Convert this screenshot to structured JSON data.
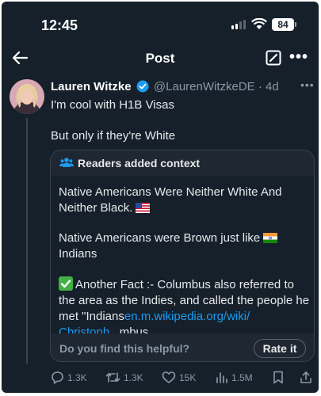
{
  "status_bar": {
    "time": "12:45",
    "battery": "84"
  },
  "header": {
    "title": "Post"
  },
  "post": {
    "author_name": "Lauren Witzke",
    "handle": "@LaurenWitzkeDE",
    "separator": "·",
    "age": "4d",
    "text_line1": "I'm cool with H1B Visas",
    "text_line2": "But only if they're White"
  },
  "context": {
    "title": "Readers added context",
    "para1": "Native Americans Were Neither White And Neither Black.",
    "para2": "Native Americans were Brown just like",
    "para2_end": "Indians",
    "para3": "Another Fact :- Columbus also referred to the area as the Indies, and called the people he met \"Indians",
    "link1": "en.m.wikipedia.org/wiki/",
    "link2": "Christoph...",
    "after_link": "mbus",
    "helpful_prompt": "Do you find this helpful?",
    "rate_label": "Rate it"
  },
  "actions": {
    "replies": "1.3K",
    "reposts": "1.3K",
    "likes": "15K",
    "views": "1.5M"
  },
  "colors": {
    "background": "#15202b",
    "accent": "#1d9bf0",
    "muted": "#8b98a5"
  },
  "icons": [
    "back-arrow-icon",
    "compose-icon",
    "more-icon",
    "verified-icon",
    "readers-icon",
    "us-flag-icon",
    "india-flag-icon",
    "check-icon",
    "reply-icon",
    "repost-icon",
    "like-icon",
    "views-icon",
    "bookmark-icon",
    "share-icon"
  ]
}
